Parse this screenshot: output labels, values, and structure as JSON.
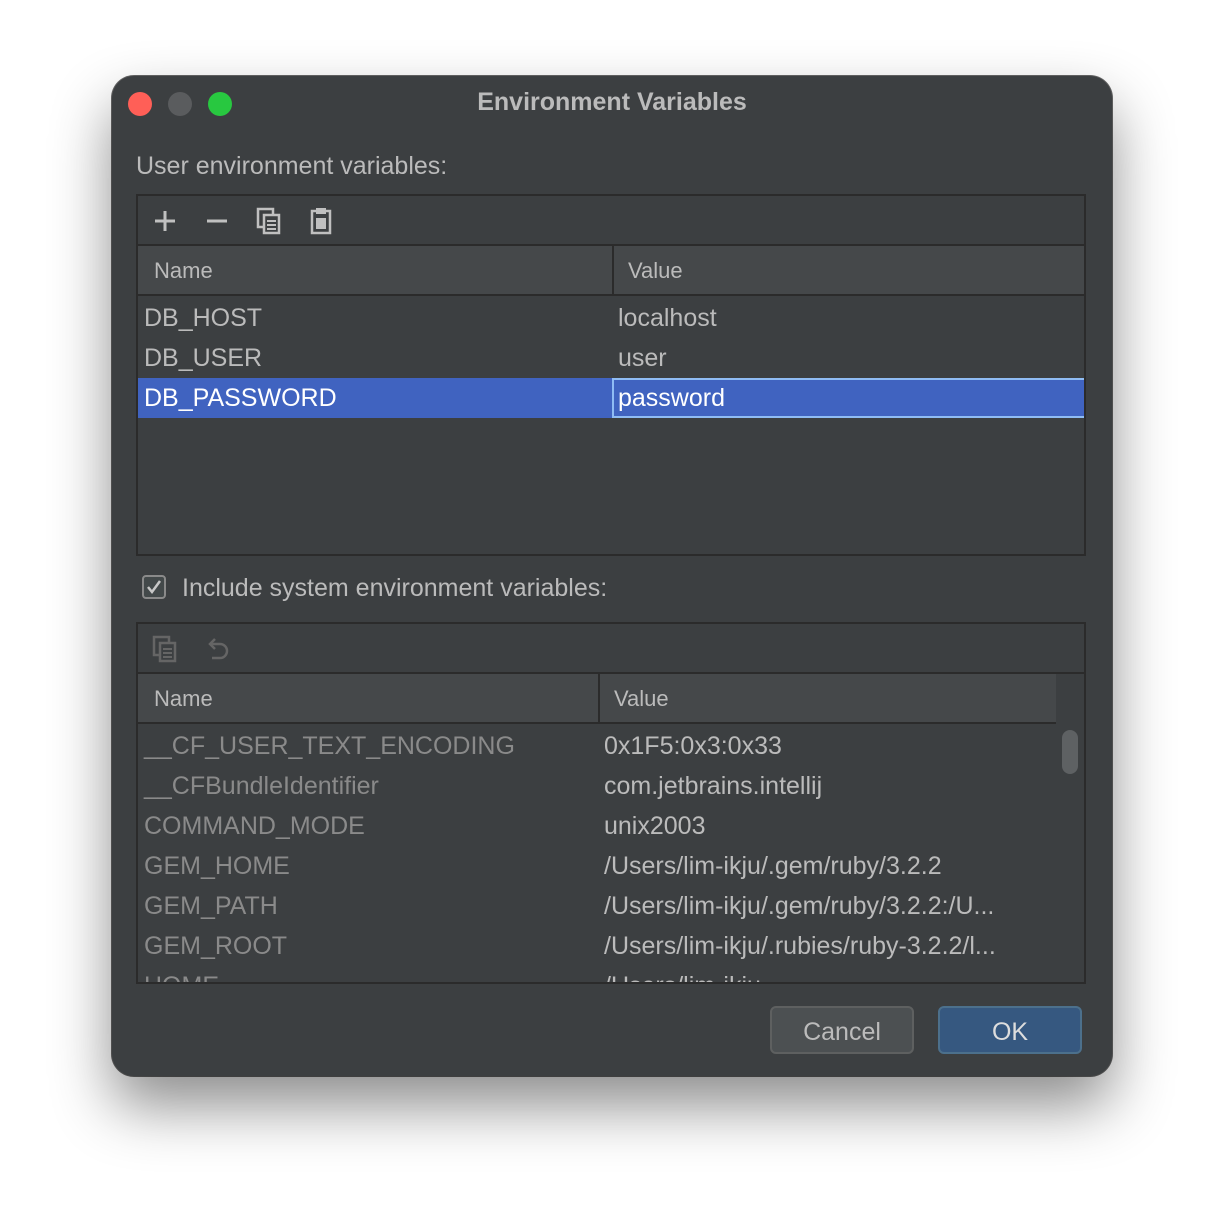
{
  "window": {
    "title": "Environment Variables"
  },
  "user_section": {
    "label": "User environment variables:",
    "columns": [
      "Name",
      "Value"
    ],
    "rows": [
      {
        "name": "DB_HOST",
        "value": "localhost"
      },
      {
        "name": "DB_USER",
        "value": "user"
      },
      {
        "name": "DB_PASSWORD",
        "value": "password"
      }
    ],
    "selected_row": 2
  },
  "system_section": {
    "label": "Include system environment variables:",
    "checked": true,
    "columns": [
      "Name",
      "Value"
    ],
    "rows": [
      {
        "name": "__CF_USER_TEXT_ENCODING",
        "value": "0x1F5:0x3:0x33"
      },
      {
        "name": "__CFBundleIdentifier",
        "value": "com.jetbrains.intellij"
      },
      {
        "name": "COMMAND_MODE",
        "value": "unix2003"
      },
      {
        "name": "GEM_HOME",
        "value": "/Users/lim-ikju/.gem/ruby/3.2.2"
      },
      {
        "name": "GEM_PATH",
        "value": "/Users/lim-ikju/.gem/ruby/3.2.2:/U..."
      },
      {
        "name": "GEM_ROOT",
        "value": "/Users/lim-ikju/.rubies/ruby-3.2.2/l..."
      },
      {
        "name": "HOME",
        "value": "/Users/lim-ikju"
      }
    ]
  },
  "buttons": {
    "cancel": "Cancel",
    "ok": "OK"
  },
  "colors": {
    "background": "#3c3f41",
    "selection": "#4063c0",
    "ok_button": "#365880"
  }
}
